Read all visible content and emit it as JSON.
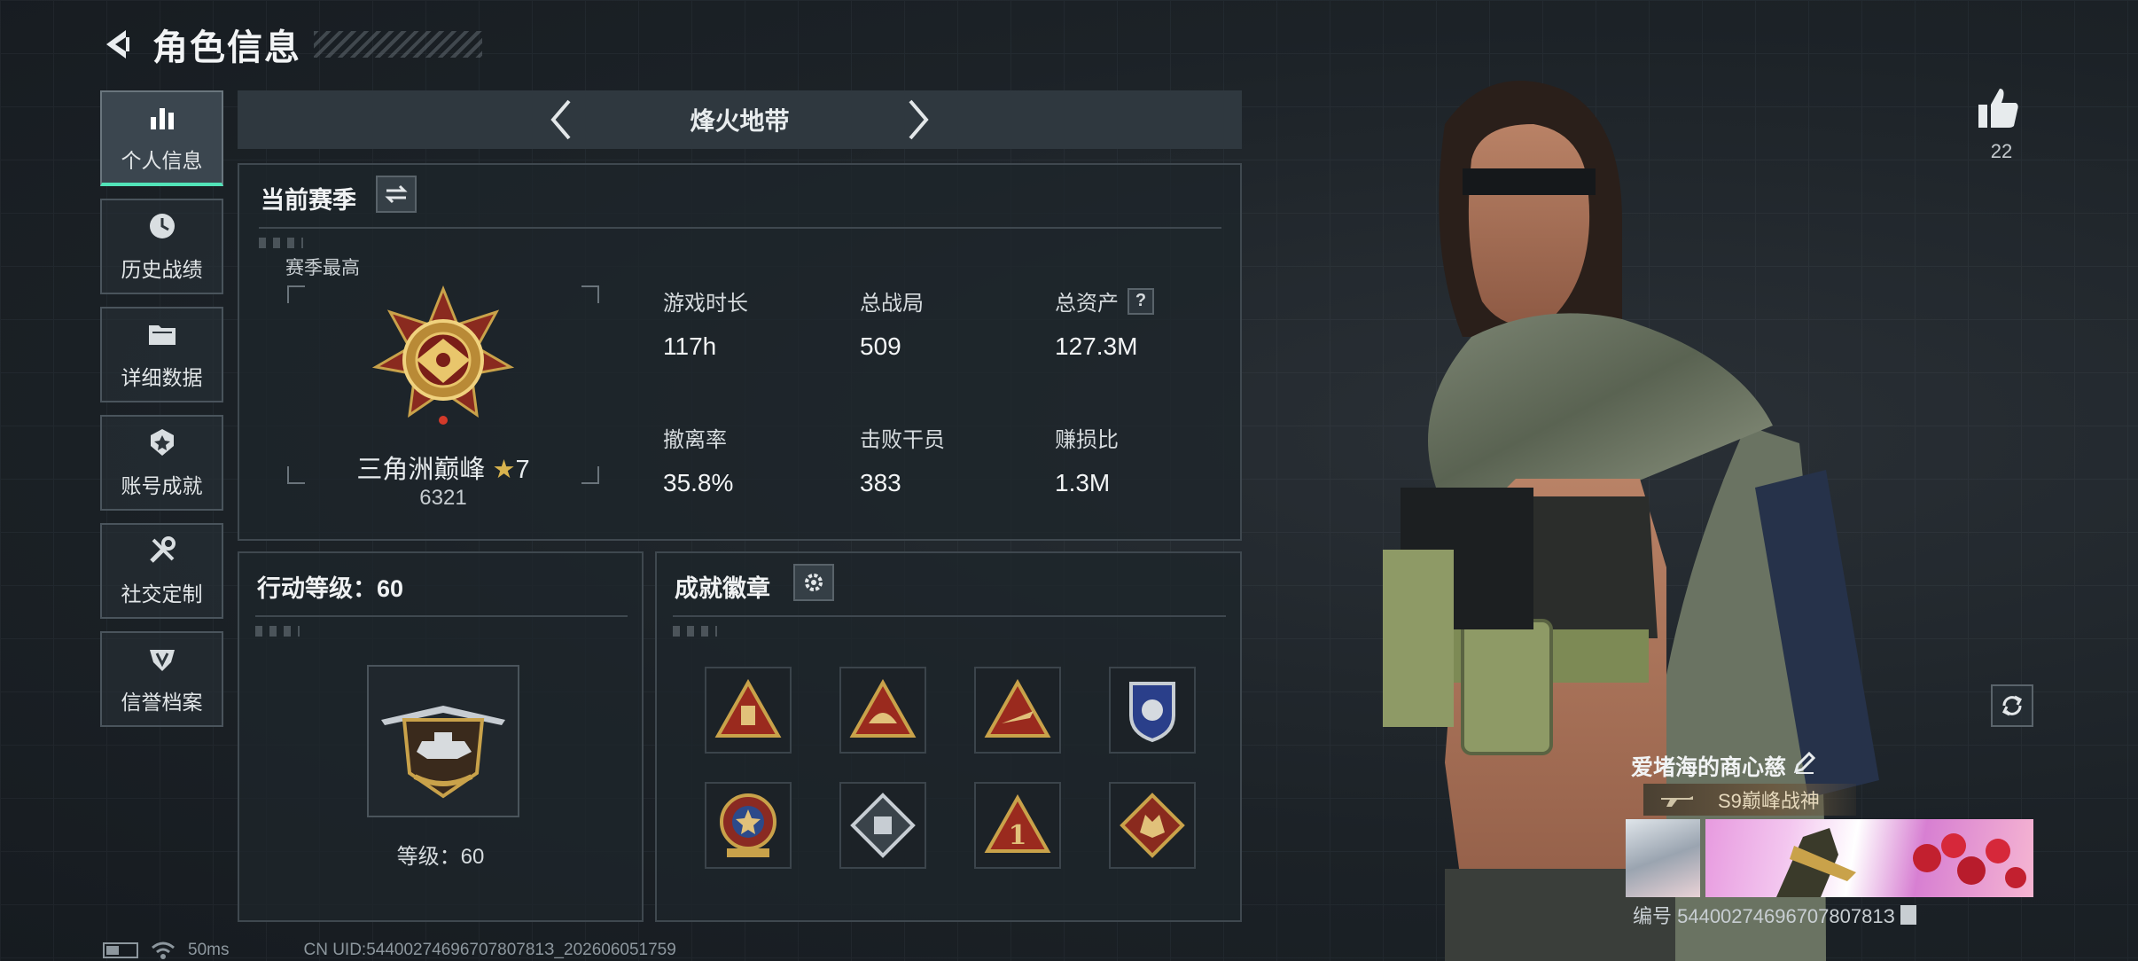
{
  "header": {
    "title": "角色信息"
  },
  "sidebar": {
    "items": [
      {
        "label": "个人信息",
        "icon": "bar-chart-icon",
        "active": true
      },
      {
        "label": "历史战绩",
        "icon": "history-clock-icon"
      },
      {
        "label": "详细数据",
        "icon": "folder-icon"
      },
      {
        "label": "账号成就",
        "icon": "achievement-icon"
      },
      {
        "label": "社交定制",
        "icon": "tools-icon"
      },
      {
        "label": "信誉档案",
        "icon": "reputation-icon"
      }
    ]
  },
  "mode": {
    "name": "烽火地带"
  },
  "season": {
    "title": "当前赛季",
    "best_label": "赛季最高",
    "rank_name": "三角洲巅峰",
    "rank_stars": "7",
    "rank_score": "6321",
    "stats": [
      {
        "label": "游戏时长",
        "value": "117h"
      },
      {
        "label": "总战局",
        "value": "509"
      },
      {
        "label": "总资产",
        "value": "127.3M",
        "help": "?"
      },
      {
        "label": "撤离率",
        "value": "35.8%"
      },
      {
        "label": "击败干员",
        "value": "383"
      },
      {
        "label": "赚损比",
        "value": "1.3M"
      }
    ]
  },
  "level": {
    "title": "行动等级：60",
    "text": "等级：60"
  },
  "badges": {
    "title": "成就徽章",
    "items": [
      "badge-1",
      "badge-2",
      "badge-3",
      "badge-4",
      "badge-5",
      "badge-6",
      "badge-7",
      "badge-8"
    ]
  },
  "likes": {
    "count": "22"
  },
  "player": {
    "name": "爱堵海的商心慈",
    "title_tag": "S9巅峰战神",
    "id_text": "编号 5440027469670780781З"
  },
  "status": {
    "latency": "50ms",
    "uid": "CN UID:5440027469670780781З_202606051759"
  },
  "colors": {
    "accent": "#52e3b8",
    "gold": "#c9a24a",
    "badge_red": "#9a2a1e"
  }
}
